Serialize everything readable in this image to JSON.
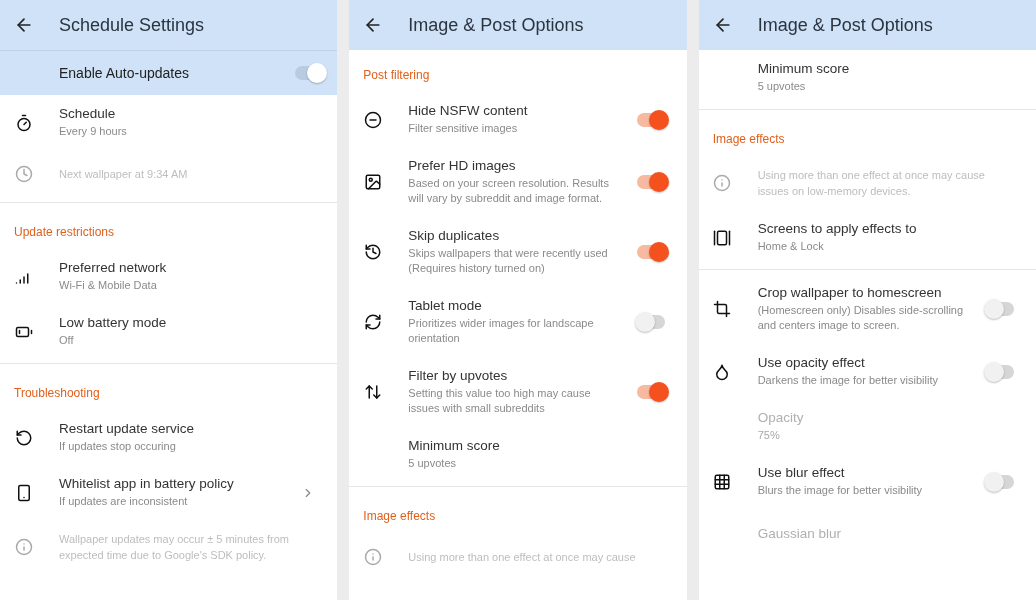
{
  "panels": [
    {
      "title": "Schedule Settings",
      "items": [
        {
          "kind": "master",
          "title": "Enable Auto-updates",
          "on": true
        },
        {
          "kind": "row",
          "title": "Schedule",
          "subtitle": "Every 9 hours"
        },
        {
          "kind": "info",
          "text": "Next wallpaper at 9:34 AM"
        },
        {
          "kind": "divider"
        },
        {
          "kind": "section",
          "title": "Update restrictions"
        },
        {
          "kind": "row",
          "title": "Preferred network",
          "subtitle": "Wi-Fi & Mobile Data"
        },
        {
          "kind": "row",
          "title": "Low battery mode",
          "subtitle": "Off"
        },
        {
          "kind": "divider"
        },
        {
          "kind": "section",
          "title": "Troubleshooting"
        },
        {
          "kind": "row",
          "title": "Restart update service",
          "subtitle": "If updates stop occuring"
        },
        {
          "kind": "row",
          "title": "Whitelist app in battery policy",
          "subtitle": "If updates are inconsistent",
          "chevron": true
        },
        {
          "kind": "info",
          "text": "Wallpaper updates may occur ± 5 minutes from expected time due to Google's SDK policy."
        }
      ]
    },
    {
      "title": "Image & Post Options",
      "items": [
        {
          "kind": "section",
          "title": "Post filtering"
        },
        {
          "kind": "row",
          "title": "Hide NSFW content",
          "subtitle": "Filter sensitive images",
          "on": true
        },
        {
          "kind": "row",
          "title": "Prefer HD images",
          "subtitle": "Based on your screen resolution. Results will vary by subreddit and image format.",
          "on": true
        },
        {
          "kind": "row",
          "title": "Skip duplicates",
          "subtitle": "Skips wallpapers that were recently used (Requires history turned on)",
          "on": true
        },
        {
          "kind": "row",
          "title": "Tablet mode",
          "subtitle": "Prioritizes wider images for landscape orientation",
          "on": false
        },
        {
          "kind": "row",
          "title": "Filter by upvotes",
          "subtitle": "Setting this value too high may cause issues with small subreddits",
          "on": true
        },
        {
          "kind": "row",
          "title": "Minimum score",
          "subtitle": "5 upvotes"
        },
        {
          "kind": "divider"
        },
        {
          "kind": "section",
          "title": "Image effects"
        },
        {
          "kind": "info",
          "text": "Using more than one effect at once may cause"
        }
      ]
    },
    {
      "title": "Image & Post Options",
      "items": [
        {
          "kind": "row",
          "title": "Minimum score",
          "subtitle": "5 upvotes"
        },
        {
          "kind": "divider"
        },
        {
          "kind": "section",
          "title": "Image effects"
        },
        {
          "kind": "info",
          "text": "Using more than one effect at once may cause issues on low-memory devices."
        },
        {
          "kind": "row",
          "title": "Screens to apply effects to",
          "subtitle": "Home & Lock"
        },
        {
          "kind": "divider"
        },
        {
          "kind": "row",
          "title": "Crop wallpaper to homescreen",
          "subtitle": "(Homescreen only) Disables side-scrolling and centers image to screen.",
          "on": false
        },
        {
          "kind": "row",
          "title": "Use opacity effect",
          "subtitle": "Darkens the image for better visibility",
          "on": false
        },
        {
          "kind": "row",
          "title": "Opacity",
          "subtitle": "75%",
          "disabled": true
        },
        {
          "kind": "row",
          "title": "Use blur effect",
          "subtitle": "Blurs the image for better visibility",
          "on": false
        },
        {
          "kind": "row",
          "title": "Gaussian blur",
          "disabled": true
        }
      ]
    }
  ]
}
